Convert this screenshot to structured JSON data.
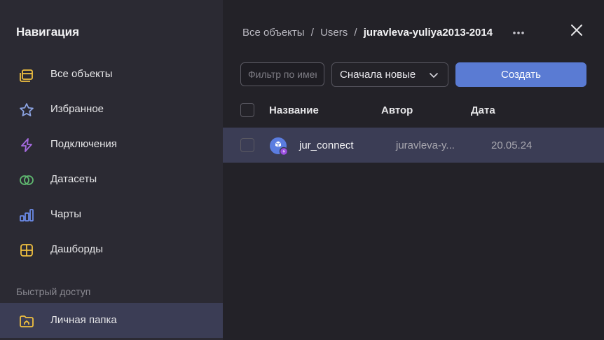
{
  "sidebar": {
    "title": "Навигация",
    "items": [
      {
        "label": "Все объекты",
        "icon": "all-objects-icon"
      },
      {
        "label": "Избранное",
        "icon": "star-icon"
      },
      {
        "label": "Подключения",
        "icon": "connection-icon"
      },
      {
        "label": "Датасеты",
        "icon": "dataset-icon"
      },
      {
        "label": "Чарты",
        "icon": "chart-icon"
      },
      {
        "label": "Дашборды",
        "icon": "dashboard-icon"
      }
    ],
    "quick_access_label": "Быстрый доступ",
    "personal_folder": {
      "label": "Личная папка",
      "icon": "personal-folder-icon"
    }
  },
  "breadcrumb": {
    "items": [
      "Все объекты",
      "Users"
    ],
    "separator": "/",
    "current": "juravleva-yuliya2013-2014"
  },
  "toolbar": {
    "filter_placeholder": "Фильтр по имени",
    "sort_label": "Сначала новые",
    "create_label": "Создать"
  },
  "table": {
    "columns": [
      "Название",
      "Автор",
      "Дата"
    ],
    "rows": [
      {
        "name": "jur_connect",
        "author": "juravleva-y...",
        "date": "20.05.24",
        "icon": "connection-object-icon"
      }
    ]
  },
  "colors": {
    "accent": "#5a7bd3",
    "sidebar_bg": "#2b2a33",
    "main_bg": "#232228",
    "selected_bg": "#3b3d55"
  }
}
